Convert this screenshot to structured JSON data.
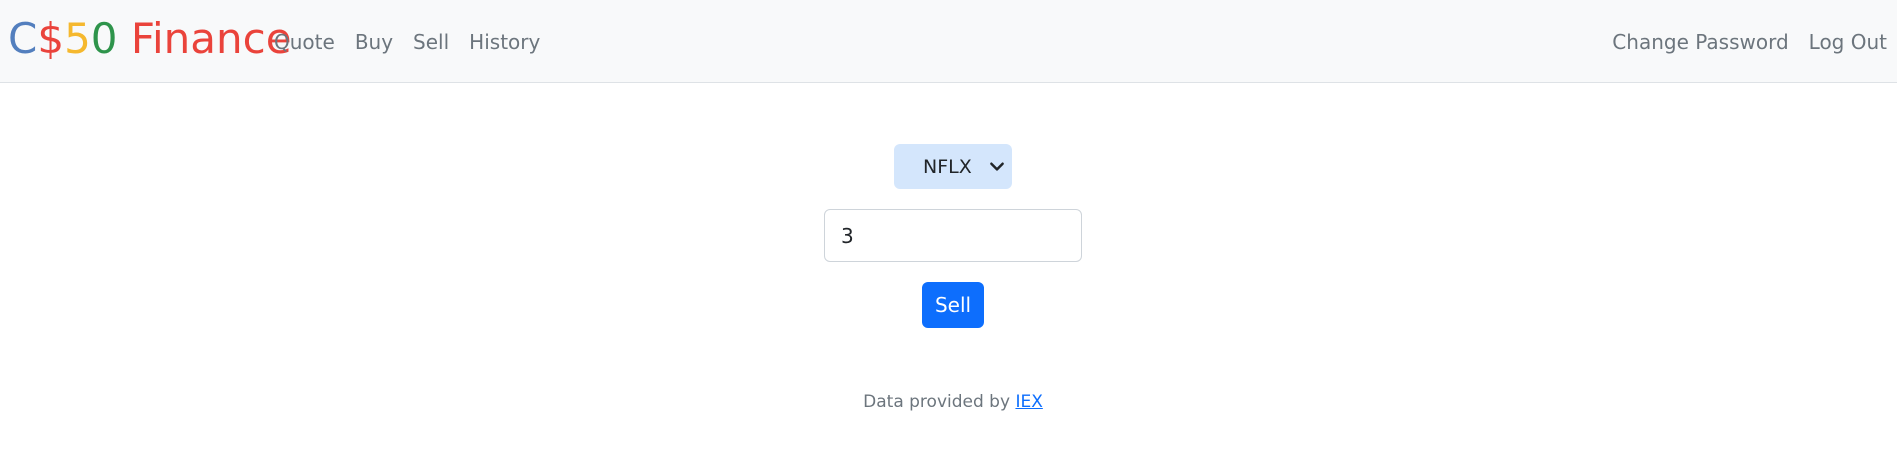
{
  "navbar": {
    "brand": {
      "c": "C",
      "dollar": "$",
      "five": "5",
      "zero": "0",
      "finance": " Finance"
    },
    "links_left": [
      "Quote",
      "Buy",
      "Sell",
      "History"
    ],
    "links_right": [
      "Change Password",
      "Log Out"
    ]
  },
  "form": {
    "symbol_selected": "NFLX",
    "shares_value": "3",
    "submit_label": "Sell"
  },
  "footer": {
    "text": "Data provided by ",
    "link_label": "IEX"
  },
  "colors": {
    "navbar_bg": "#f8f9fa",
    "primary": "#0d6efd",
    "select_bg": "#d4e6fc",
    "brand_blue": "#537fbe",
    "brand_red": "#ea433b",
    "brand_yellow": "#f5b82e",
    "brand_green": "#2e944b"
  },
  "icons": {
    "select_arrow": "chevron-down-icon"
  }
}
